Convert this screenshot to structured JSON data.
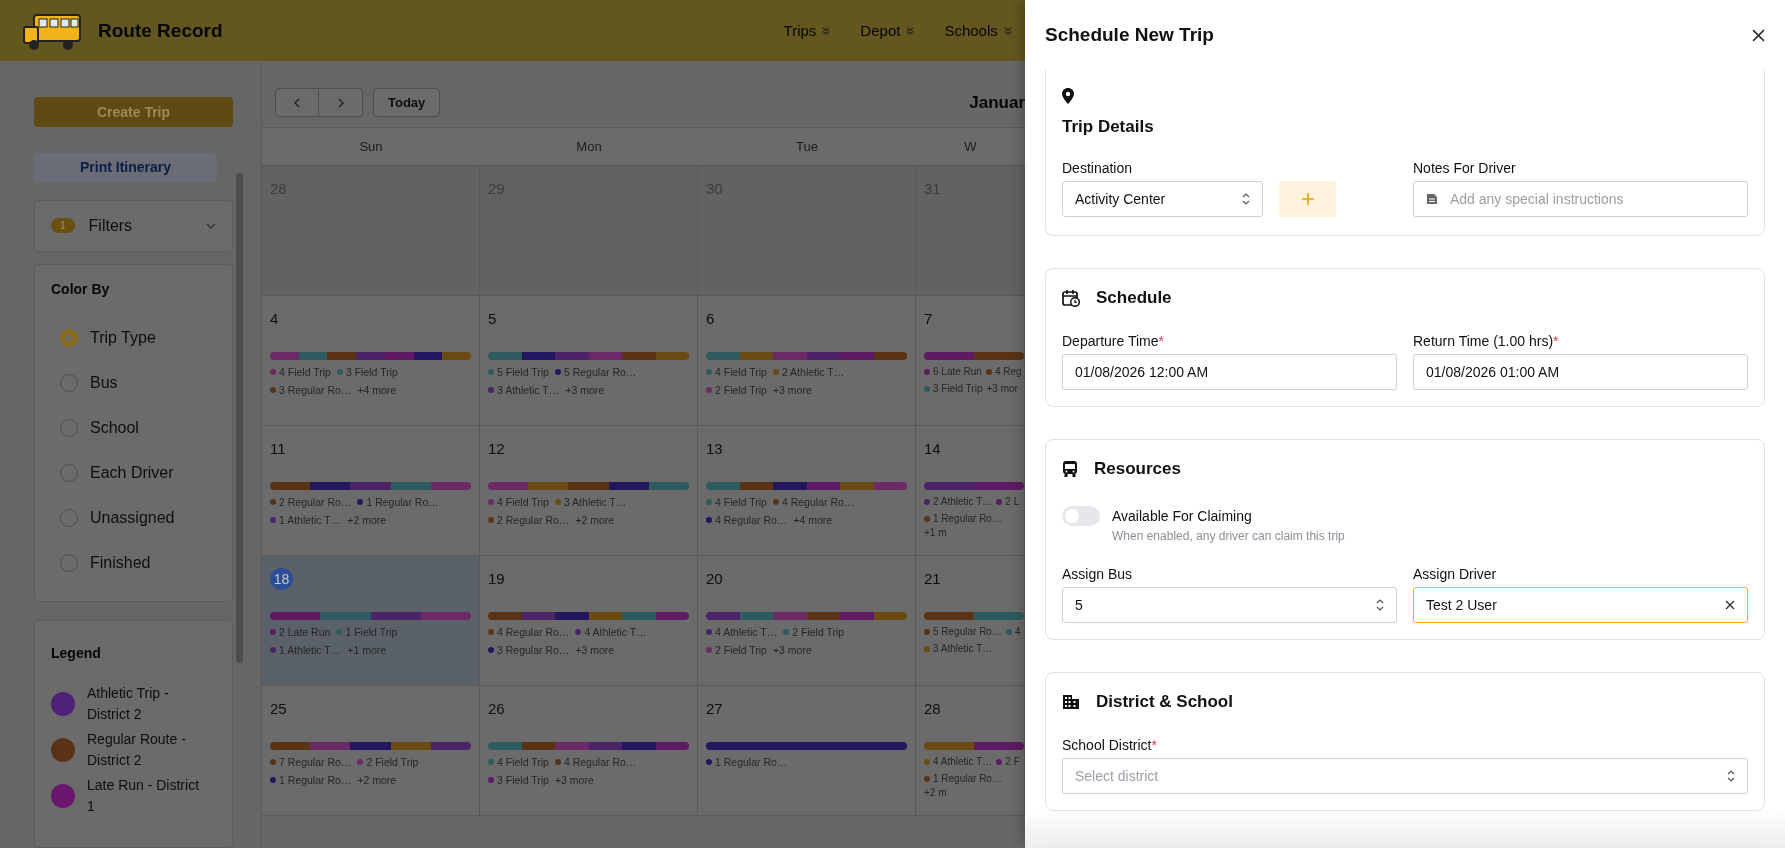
{
  "header": {
    "app_name": "Route Record",
    "nav": [
      {
        "label": "Trips"
      },
      {
        "label": "Depot"
      },
      {
        "label": "Schools"
      }
    ]
  },
  "sidebar": {
    "create_button": "Create Trip",
    "print_button": "Print Itinerary",
    "filters": {
      "label": "Filters",
      "count": "1"
    },
    "color_by": {
      "title": "Color By",
      "options": [
        {
          "label": "Trip Type",
          "selected": true
        },
        {
          "label": "Bus",
          "selected": false
        },
        {
          "label": "School",
          "selected": false
        },
        {
          "label": "Each Driver",
          "selected": false
        },
        {
          "label": "Unassigned",
          "selected": false
        },
        {
          "label": "Finished",
          "selected": false
        }
      ]
    },
    "legend": {
      "title": "Legend",
      "items": [
        {
          "label": "Athletic Trip - District 2",
          "color": "#4f2178"
        },
        {
          "label": "Regular Route - District 2",
          "color": "#5a3217"
        },
        {
          "label": "Late Run - District 1",
          "color": "#6a1570"
        }
      ]
    }
  },
  "calendar": {
    "today_button": "Today",
    "title": "Januar",
    "weekdays": [
      "Sun",
      "Mon",
      "Tue",
      "W"
    ],
    "weeks": [
      [
        {
          "day": "28",
          "outside": true,
          "today": false
        },
        {
          "day": "29",
          "outside": true,
          "today": false
        },
        {
          "day": "30",
          "outside": true,
          "today": false
        },
        {
          "day": "31",
          "outside": true,
          "today": false
        }
      ],
      [
        {
          "day": "4",
          "outside": false,
          "today": false,
          "segments": [
            {
              "color": "#6b2a66"
            },
            {
              "color": "#2e5c5e"
            },
            {
              "color": "#5a3214"
            },
            {
              "color": "#4b2468"
            },
            {
              "color": "#5e1a62"
            },
            {
              "color": "#241760"
            },
            {
              "color": "#6b4a14"
            }
          ],
          "items": [
            {
              "label": "4 Field Trip",
              "color": "#6b2a66"
            },
            {
              "label": "3 Field Trip",
              "color": "#2e5c5e"
            },
            {
              "label": "3 Regular Ro…",
              "color": "#5a3214"
            }
          ],
          "more": "+4 more"
        },
        {
          "day": "5",
          "outside": false,
          "today": false,
          "segments": [
            {
              "color": "#2e5c5e"
            },
            {
              "color": "#241760"
            },
            {
              "color": "#4b2468"
            },
            {
              "color": "#6b2a66"
            },
            {
              "color": "#5a3214"
            },
            {
              "color": "#6b4a14"
            }
          ],
          "items": [
            {
              "label": "5 Field Trip",
              "color": "#2e5c5e"
            },
            {
              "label": "5 Regular Ro…",
              "color": "#241760"
            },
            {
              "label": "3 Athletic T…",
              "color": "#4b2468"
            }
          ],
          "more": "+3 more"
        },
        {
          "day": "6",
          "outside": false,
          "today": false,
          "segments": [
            {
              "color": "#2e5c5e"
            },
            {
              "color": "#6b4a14"
            },
            {
              "color": "#6b2a66"
            },
            {
              "color": "#4b2468"
            },
            {
              "color": "#5e1a62"
            },
            {
              "color": "#5a3214"
            }
          ],
          "items": [
            {
              "label": "4 Field Trip",
              "color": "#2e5c5e"
            },
            {
              "label": "2 Athletic T…",
              "color": "#6b4a14"
            },
            {
              "label": "2 Field Trip",
              "color": "#6b2a66"
            }
          ],
          "more": "+3 more"
        },
        {
          "day": "7",
          "outside": false,
          "today": false,
          "segments": [
            {
              "color": "#5e1a62"
            },
            {
              "color": "#5a3214"
            }
          ],
          "items": [
            {
              "label": "6 Late Run",
              "color": "#5e1a62"
            },
            {
              "label": "4 Reg",
              "color": "#5a3214"
            },
            {
              "label": "3 Field Trip",
              "color": "#2e5c5e"
            }
          ],
          "more": "+3 mor"
        }
      ],
      [
        {
          "day": "11",
          "outside": false,
          "today": false,
          "segments": [
            {
              "color": "#5a3214"
            },
            {
              "color": "#241760"
            },
            {
              "color": "#4b2468"
            },
            {
              "color": "#2e5c5e"
            },
            {
              "color": "#6b2a66"
            }
          ],
          "items": [
            {
              "label": "2 Regular Ro…",
              "color": "#5a3214"
            },
            {
              "label": "1 Regular Ro…",
              "color": "#241760"
            },
            {
              "label": "1 Athletic T…",
              "color": "#4b2468"
            }
          ],
          "more": "+2 more"
        },
        {
          "day": "12",
          "outside": false,
          "today": false,
          "segments": [
            {
              "color": "#6b2a66"
            },
            {
              "color": "#6b4a14"
            },
            {
              "color": "#5a3214"
            },
            {
              "color": "#241760"
            },
            {
              "color": "#2e5c5e"
            }
          ],
          "items": [
            {
              "label": "4 Field Trip",
              "color": "#6b2a66"
            },
            {
              "label": "3 Athletic T…",
              "color": "#6b4a14"
            },
            {
              "label": "2 Regular Ro…",
              "color": "#5a3214"
            }
          ],
          "more": "+2 more"
        },
        {
          "day": "13",
          "outside": false,
          "today": false,
          "segments": [
            {
              "color": "#2e5c5e"
            },
            {
              "color": "#5a3214"
            },
            {
              "color": "#241760"
            },
            {
              "color": "#5e1a62"
            },
            {
              "color": "#6b4a14"
            },
            {
              "color": "#6b2a66"
            }
          ],
          "items": [
            {
              "label": "4 Field Trip",
              "color": "#2e5c5e"
            },
            {
              "label": "4 Regular Ro…",
              "color": "#5a3214"
            },
            {
              "label": "4 Regular Ro…",
              "color": "#241760"
            }
          ],
          "more": "+4 more"
        },
        {
          "day": "14",
          "outside": false,
          "today": false,
          "segments": [
            {
              "color": "#4b2468"
            },
            {
              "color": "#5e1a62"
            }
          ],
          "items": [
            {
              "label": "2 Athletic T…",
              "color": "#4b2468"
            },
            {
              "label": "2 L",
              "color": "#5e1a62"
            },
            {
              "label": "1 Regular Ro…",
              "color": "#5a3214"
            }
          ],
          "more": "+1 m"
        }
      ],
      [
        {
          "day": "18",
          "outside": false,
          "today": true,
          "segments": [
            {
              "color": "#5e1a62"
            },
            {
              "color": "#2e5c5e"
            },
            {
              "color": "#4b2468"
            },
            {
              "color": "#6b2a66"
            }
          ],
          "items": [
            {
              "label": "2 Late Run",
              "color": "#5e1a62"
            },
            {
              "label": "1 Field Trip",
              "color": "#2e5c5e"
            },
            {
              "label": "1 Athletic T…",
              "color": "#4b2468"
            }
          ],
          "more": "+1 more"
        },
        {
          "day": "19",
          "outside": false,
          "today": false,
          "segments": [
            {
              "color": "#5a3214"
            },
            {
              "color": "#4b2468"
            },
            {
              "color": "#241760"
            },
            {
              "color": "#6b4a14"
            },
            {
              "color": "#2e5c5e"
            },
            {
              "color": "#5e1a62"
            }
          ],
          "items": [
            {
              "label": "4 Regular Ro…",
              "color": "#5a3214"
            },
            {
              "label": "4 Athletic T…",
              "color": "#4b2468"
            },
            {
              "label": "3 Regular Ro…",
              "color": "#241760"
            }
          ],
          "more": "+3 more"
        },
        {
          "day": "20",
          "outside": false,
          "today": false,
          "segments": [
            {
              "color": "#4b2468"
            },
            {
              "color": "#2e5c5e"
            },
            {
              "color": "#6b2a66"
            },
            {
              "color": "#5a3214"
            },
            {
              "color": "#5e1a62"
            },
            {
              "color": "#6b4a14"
            }
          ],
          "items": [
            {
              "label": "4 Athletic T…",
              "color": "#4b2468"
            },
            {
              "label": "2 Field Trip",
              "color": "#2e5c5e"
            },
            {
              "label": "2 Field Trip",
              "color": "#6b2a66"
            }
          ],
          "more": "+3 more"
        },
        {
          "day": "21",
          "outside": false,
          "today": false,
          "segments": [
            {
              "color": "#5a3214"
            },
            {
              "color": "#2e5c5e"
            }
          ],
          "items": [
            {
              "label": "5 Regular Ro…",
              "color": "#5a3214"
            },
            {
              "label": "4",
              "color": "#2e5c5e"
            },
            {
              "label": "3 Athletic T…",
              "color": "#6b4a14"
            }
          ]
        }
      ],
      [
        {
          "day": "25",
          "outside": false,
          "today": false,
          "segments": [
            {
              "color": "#5a3214"
            },
            {
              "color": "#6b2a66"
            },
            {
              "color": "#241760"
            },
            {
              "color": "#6b4a14"
            },
            {
              "color": "#4b2468"
            }
          ],
          "items": [
            {
              "label": "7 Regular Ro…",
              "color": "#5a3214"
            },
            {
              "label": "2 Field Trip",
              "color": "#6b2a66"
            },
            {
              "label": "1 Regular Ro…",
              "color": "#241760"
            }
          ],
          "more": "+2 more"
        },
        {
          "day": "26",
          "outside": false,
          "today": false,
          "segments": [
            {
              "color": "#2e5c5e"
            },
            {
              "color": "#5a3214"
            },
            {
              "color": "#6b2a66"
            },
            {
              "color": "#4b2468"
            },
            {
              "color": "#241760"
            },
            {
              "color": "#5e1a62"
            }
          ],
          "items": [
            {
              "label": "4 Field Trip",
              "color": "#2e5c5e"
            },
            {
              "label": "4 Regular Ro…",
              "color": "#5a3214"
            },
            {
              "label": "3 Field Trip",
              "color": "#5e1a62"
            }
          ],
          "more": "+3 more"
        },
        {
          "day": "27",
          "outside": false,
          "today": false,
          "segments": [
            {
              "color": "#241760"
            }
          ],
          "items": [
            {
              "label": "1 Regular Ro…",
              "color": "#241760"
            }
          ]
        },
        {
          "day": "28",
          "outside": false,
          "today": false,
          "segments": [
            {
              "color": "#6b4a14"
            },
            {
              "color": "#5e1a62"
            }
          ],
          "items": [
            {
              "label": "4 Athletic T…",
              "color": "#6b4a14"
            },
            {
              "label": "2 F",
              "color": "#5e1a62"
            },
            {
              "label": "1 Regular Ro…",
              "color": "#5a3214"
            }
          ],
          "more": "+2 m"
        }
      ]
    ]
  },
  "panel": {
    "title": "Schedule New Trip",
    "trip_details": {
      "title": "Trip Details",
      "destination": {
        "label": "Destination",
        "value": "Activity Center"
      },
      "notes": {
        "label": "Notes For Driver",
        "placeholder": "Add any special instructions"
      }
    },
    "schedule": {
      "title": "Schedule",
      "departure": {
        "label": "Departure Time",
        "required_mark": "*",
        "value": "01/08/2026 12:00 AM"
      },
      "return": {
        "label": "Return Time (1.00 hrs)",
        "required_mark": "*",
        "value": "01/08/2026 01:00 AM"
      }
    },
    "resources": {
      "title": "Resources",
      "claiming": {
        "label": "Available For Claiming",
        "hint": "When enabled, any driver can claim this trip",
        "on": false
      },
      "bus": {
        "label": "Assign Bus",
        "value": "5"
      },
      "driver": {
        "label": "Assign Driver",
        "value": "Test 2 User",
        "focused": true
      }
    },
    "district_school": {
      "title": "District & School",
      "district": {
        "label": "School District",
        "required_mark": "*",
        "placeholder": "Select district"
      }
    }
  }
}
